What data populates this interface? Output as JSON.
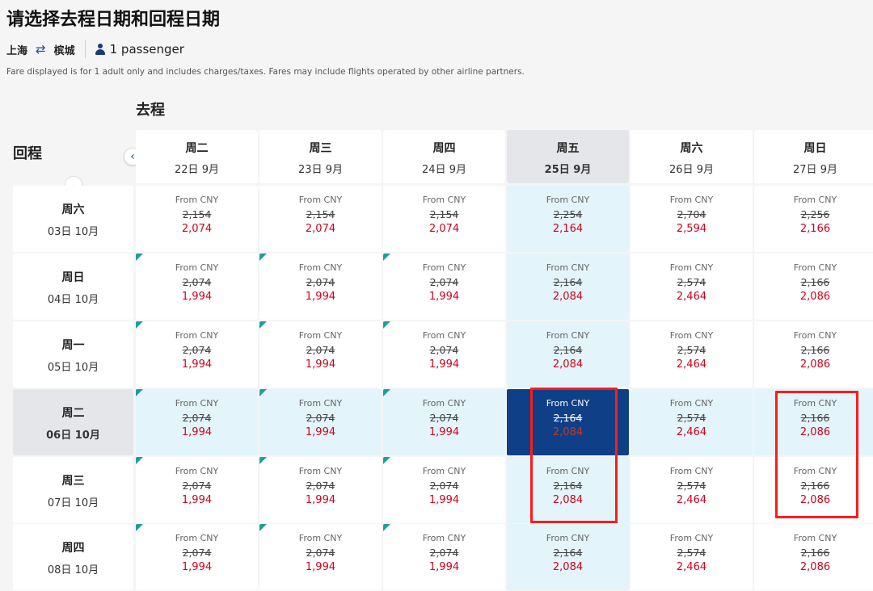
{
  "header": {
    "title": "请选择去程日期和回程日期",
    "origin": "上海",
    "destination": "槟城",
    "swap_icon": "⇄",
    "passengers": "1 passenger",
    "notice": "Fare displayed is for 1 adult only and includes charges/taxes. Fares may include flights operated by other airline partners."
  },
  "labels": {
    "outbound": "去程",
    "return": "回程",
    "prev_icon": "‹",
    "up_icon": "︿"
  },
  "colors": {
    "accent": "#1a4f9c",
    "selected_cell": "#0f3f87",
    "highlight_cell": "#e3f4fb",
    "price_red": "#d0021b",
    "annotation_red": "#ff1b1b",
    "corner_teal": "#1aa098"
  },
  "outbound_dates": [
    {
      "weekday": "周二",
      "date": "22日 9月"
    },
    {
      "weekday": "周三",
      "date": "23日 9月"
    },
    {
      "weekday": "周四",
      "date": "24日 9月"
    },
    {
      "weekday": "周五",
      "date": "25日 9月"
    },
    {
      "weekday": "周六",
      "date": "26日 9月"
    },
    {
      "weekday": "周日",
      "date": "27日 9月"
    }
  ],
  "return_dates": [
    {
      "weekday": "周六",
      "date": "03日 10月"
    },
    {
      "weekday": "周日",
      "date": "04日 10月"
    },
    {
      "weekday": "周一",
      "date": "05日 10月"
    },
    {
      "weekday": "周二",
      "date": "06日 10月"
    },
    {
      "weekday": "周三",
      "date": "07日 10月"
    },
    {
      "weekday": "周四",
      "date": "08日 10月"
    }
  ],
  "fare_prefix": "From CNY",
  "fares": [
    [
      [
        "2,154",
        "2,074"
      ],
      [
        "2,154",
        "2,074"
      ],
      [
        "2,154",
        "2,074"
      ],
      [
        "2,254",
        "2,164"
      ],
      [
        "2,704",
        "2,594"
      ],
      [
        "2,256",
        "2,166"
      ]
    ],
    [
      [
        "2,074",
        "1,994"
      ],
      [
        "2,074",
        "1,994"
      ],
      [
        "2,074",
        "1,994"
      ],
      [
        "2,164",
        "2,084"
      ],
      [
        "2,574",
        "2,464"
      ],
      [
        "2,166",
        "2,086"
      ]
    ],
    [
      [
        "2,074",
        "1,994"
      ],
      [
        "2,074",
        "1,994"
      ],
      [
        "2,074",
        "1,994"
      ],
      [
        "2,164",
        "2,084"
      ],
      [
        "2,574",
        "2,464"
      ],
      [
        "2,166",
        "2,086"
      ]
    ],
    [
      [
        "2,074",
        "1,994"
      ],
      [
        "2,074",
        "1,994"
      ],
      [
        "2,074",
        "1,994"
      ],
      [
        "2,164",
        "2,084"
      ],
      [
        "2,574",
        "2,464"
      ],
      [
        "2,166",
        "2,086"
      ]
    ],
    [
      [
        "2,074",
        "1,994"
      ],
      [
        "2,074",
        "1,994"
      ],
      [
        "2,074",
        "1,994"
      ],
      [
        "2,164",
        "2,084"
      ],
      [
        "2,574",
        "2,464"
      ],
      [
        "2,166",
        "2,086"
      ]
    ],
    [
      [
        "2,074",
        "1,994"
      ],
      [
        "2,074",
        "1,994"
      ],
      [
        "2,074",
        "1,994"
      ],
      [
        "2,164",
        "2,084"
      ],
      [
        "2,574",
        "2,464"
      ],
      [
        "2,166",
        "2,086"
      ]
    ]
  ],
  "selection": {
    "outbound_index": 3,
    "return_index": 3
  }
}
